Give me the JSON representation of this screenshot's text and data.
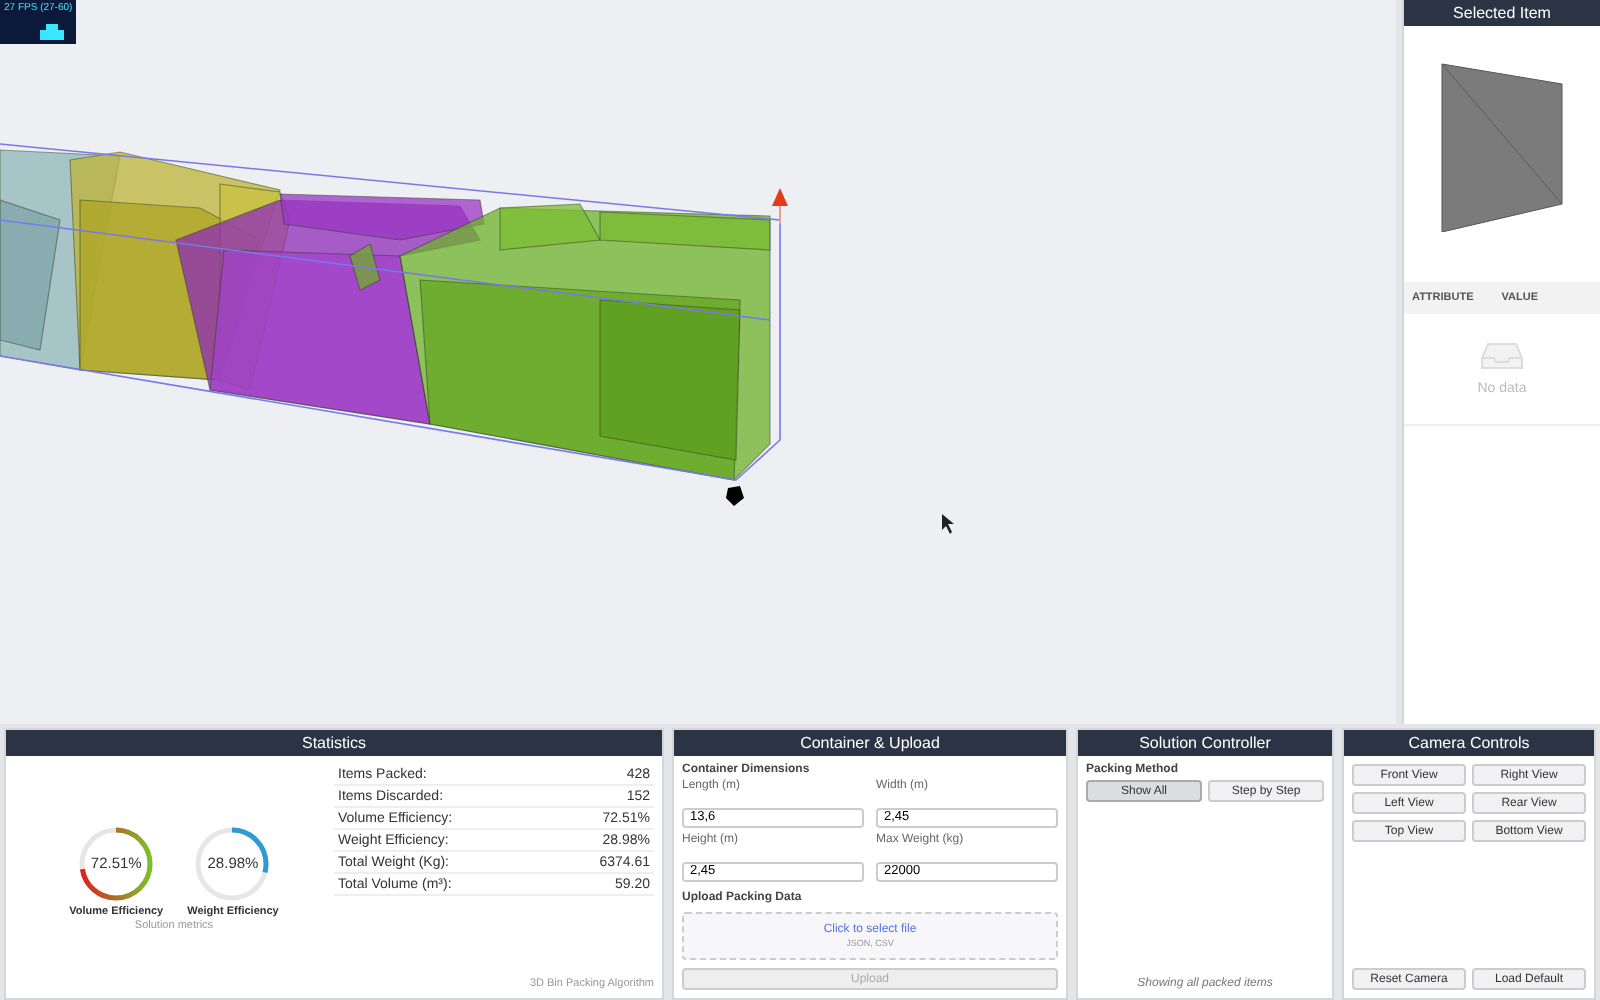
{
  "fps_meter": {
    "label": "27 FPS (27-60)"
  },
  "selected_item": {
    "title": "Selected Item",
    "columns": [
      "ATTRIBUTE",
      "VALUE"
    ],
    "empty_text": "No data"
  },
  "statistics": {
    "title": "Statistics",
    "gauges": [
      {
        "label": "Volume Efficiency",
        "reading": "72.51%",
        "level": 0.7251,
        "kind": "gradient"
      },
      {
        "label": "Weight Efficiency",
        "reading": "28.98%",
        "level": 0.2898,
        "kind": "solid"
      }
    ],
    "gauges_caption": "Solution metrics",
    "rows": [
      {
        "label": "Items Packed:",
        "value": "428"
      },
      {
        "label": "Items Discarded:",
        "value": "152"
      },
      {
        "label": "Volume Efficiency:",
        "value": "72.51%"
      },
      {
        "label": "Weight Efficiency:",
        "value": "28.98%"
      },
      {
        "label": "Total Weight (Kg):",
        "value": "6374.61"
      },
      {
        "label": "Total Volume (m³):",
        "value": "59.20"
      }
    ],
    "footer": "3D Bin Packing Algorithm"
  },
  "container_upload": {
    "title": "Container & Upload",
    "section": "Container Dimensions",
    "fields": [
      {
        "label": "Length (m)",
        "value": "13,6"
      },
      {
        "label": "Width (m)",
        "value": "2,45"
      },
      {
        "label": "Height (m)",
        "value": "2,45"
      },
      {
        "label": "Max Weight (kg)",
        "value": "22000"
      }
    ],
    "upload_section": "Upload Packing Data",
    "dropzone_link": "Click to select file",
    "dropzone_hint": "JSON, CSV",
    "upload_button": {
      "label": "Upload",
      "disabled": true
    }
  },
  "solution_controller": {
    "title": "Solution Controller",
    "section": "Packing Method",
    "methods": [
      {
        "label": "Show All",
        "selected": true
      },
      {
        "label": "Step by Step",
        "selected": false
      }
    ],
    "status": "Showing all packed items"
  },
  "camera_controls": {
    "title": "Camera Controls",
    "views": [
      "Front View",
      "Right View",
      "Left View",
      "Rear View",
      "Top View",
      "Bottom View"
    ],
    "actions": [
      "Reset Camera",
      "Load Default"
    ]
  }
}
